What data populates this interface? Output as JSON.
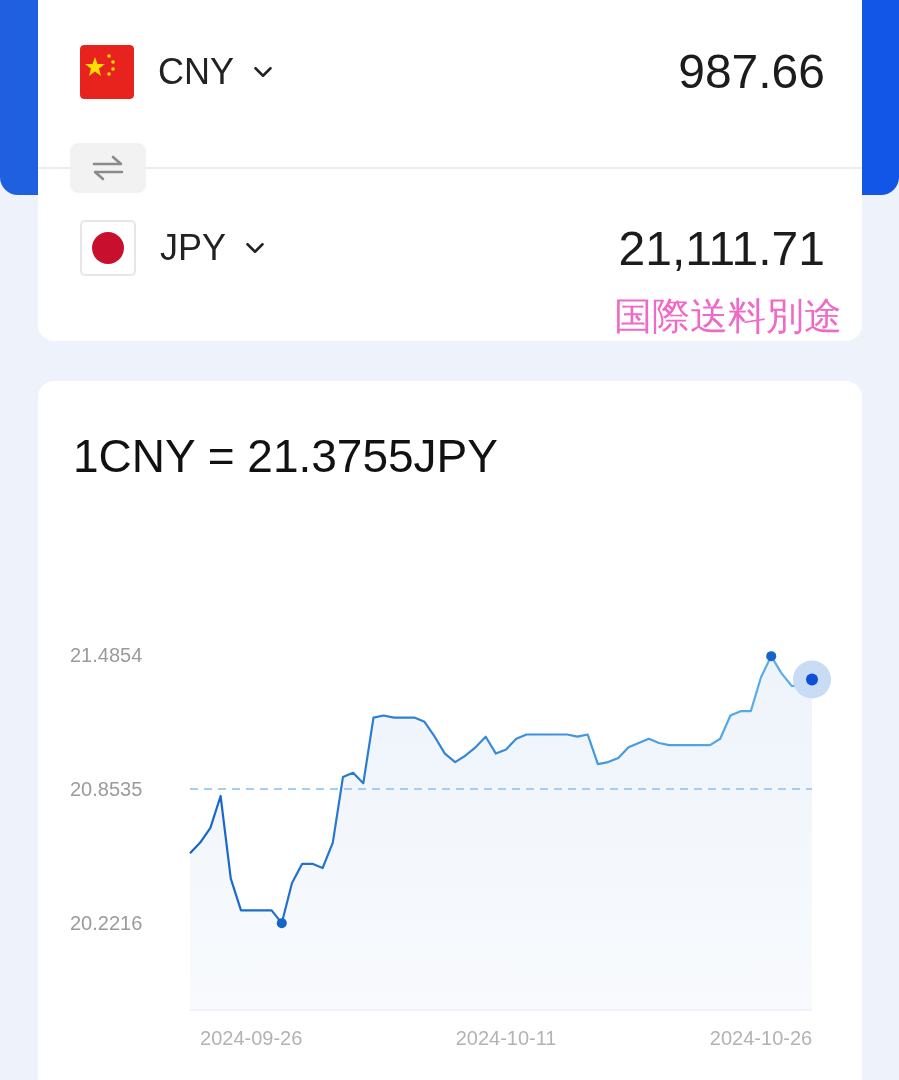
{
  "converter": {
    "currencies": [
      {
        "code": "CNY",
        "kind": "cn",
        "amount": "987.66"
      },
      {
        "code": "JPY",
        "kind": "jp",
        "amount": "21,111.71"
      }
    ],
    "note": "国際送料別途"
  },
  "rate": {
    "title": "1CNY = 21.3755JPY",
    "chart_data": {
      "type": "area",
      "yticks": [
        20.2216,
        20.8535,
        21.4854
      ],
      "ylim": [
        19.81,
        21.4854
      ],
      "categories": [
        null,
        null,
        null,
        null,
        null,
        null,
        "2024-09-26",
        null,
        null,
        null,
        null,
        null,
        null,
        null,
        null,
        null,
        null,
        null,
        null,
        null,
        null,
        null,
        null,
        null,
        null,
        null,
        null,
        null,
        null,
        null,
        null,
        "2024-10-11",
        null,
        null,
        null,
        null,
        null,
        null,
        null,
        null,
        null,
        null,
        null,
        null,
        null,
        null,
        null,
        null,
        null,
        null,
        null,
        null,
        null,
        null,
        null,
        null,
        "2024-10-26",
        null,
        null,
        null,
        null,
        null
      ],
      "series": [
        {
          "color": "#1565c8",
          "values": [
            20.55,
            20.6,
            20.67,
            20.82,
            20.43,
            20.28,
            20.28,
            20.28,
            20.28,
            20.22,
            20.41,
            20.5,
            20.5,
            20.48,
            20.6,
            20.91,
            20.93,
            20.88,
            21.19,
            21.2,
            21.19,
            21.19,
            21.19,
            21.17,
            21.1,
            21.02,
            20.98,
            21.01,
            21.05,
            21.1,
            21.02,
            21.04,
            21.09,
            21.11,
            21.11,
            21.11,
            21.11,
            21.11,
            21.1,
            21.11,
            20.97,
            20.98,
            21,
            21.05,
            21.07,
            21.09,
            21.07,
            21.06,
            21.06,
            21.06,
            21.06,
            21.06,
            21.09,
            21.2,
            21.22,
            21.22,
            21.38,
            21.48,
            21.4,
            21.34,
            21.34,
            21.37
          ]
        }
      ],
      "ref_lines": [
        {
          "axis": "y",
          "value": 20.8535
        }
      ]
    }
  }
}
